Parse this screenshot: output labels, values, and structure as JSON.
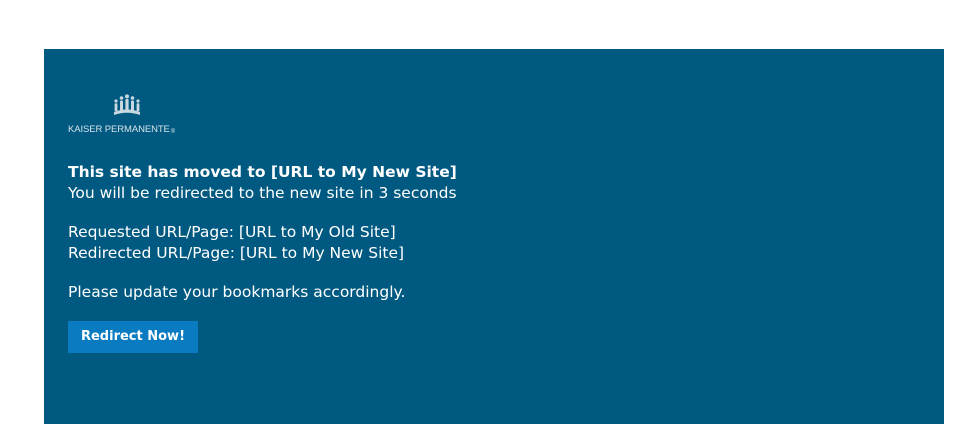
{
  "logo": {
    "text": "KAISER PERMANENTE",
    "registered": "®"
  },
  "heading": "This site has moved to [URL to My New Site]",
  "redirect_notice": "You will be redirected to the new site in 3 seconds",
  "requested_url": "Requested URL/Page: [URL to My Old Site]",
  "redirected_url": "Redirected URL/Page: [URL to My New Site]",
  "bookmark_notice": "Please update your bookmarks accordingly.",
  "redirect_button_label": "Redirect Now!",
  "colors": {
    "panel_background": "#005980",
    "button_background": "#0a7bc0",
    "text": "#ffffff"
  }
}
